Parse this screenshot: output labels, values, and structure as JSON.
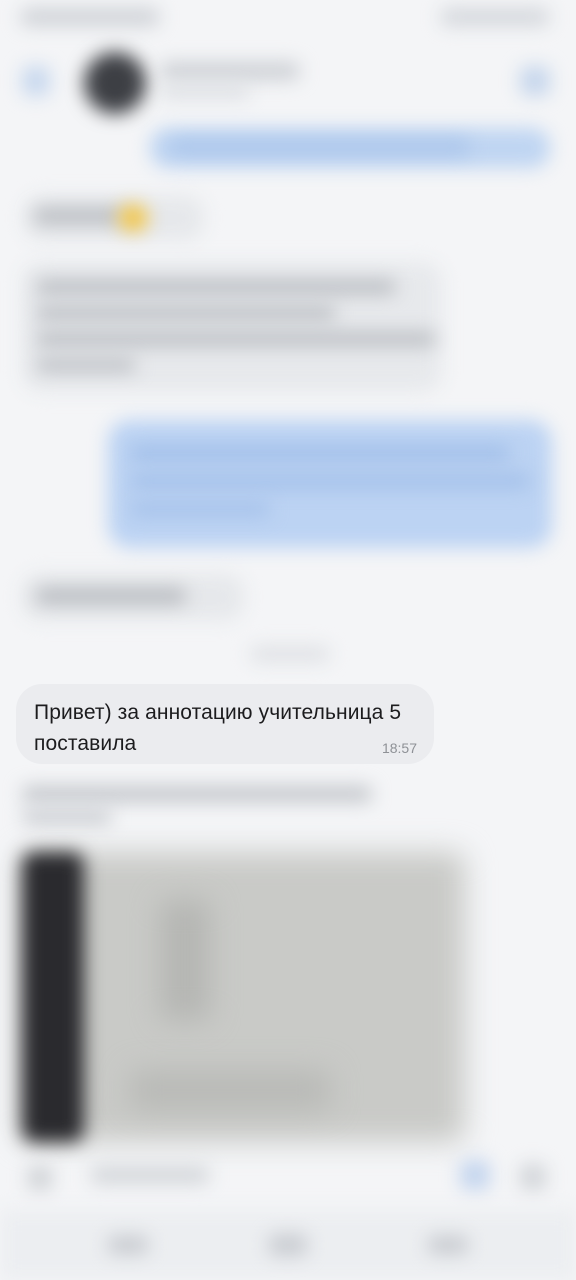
{
  "chat": {
    "focused_message": {
      "text": "Привет) за аннотацию учительница 5 поставила",
      "time": "18:57"
    }
  },
  "colors": {
    "background": "#f4f5f7",
    "incoming_bubble": "#ebecef",
    "outgoing_bubble": "#bcd3f3",
    "timestamp": "#8e9196"
  },
  "icons": {
    "back": "back-arrow-icon",
    "call": "phone-icon",
    "attach": "paperclip-icon",
    "voice": "microphone-icon",
    "emoji": "emoji-icon"
  }
}
